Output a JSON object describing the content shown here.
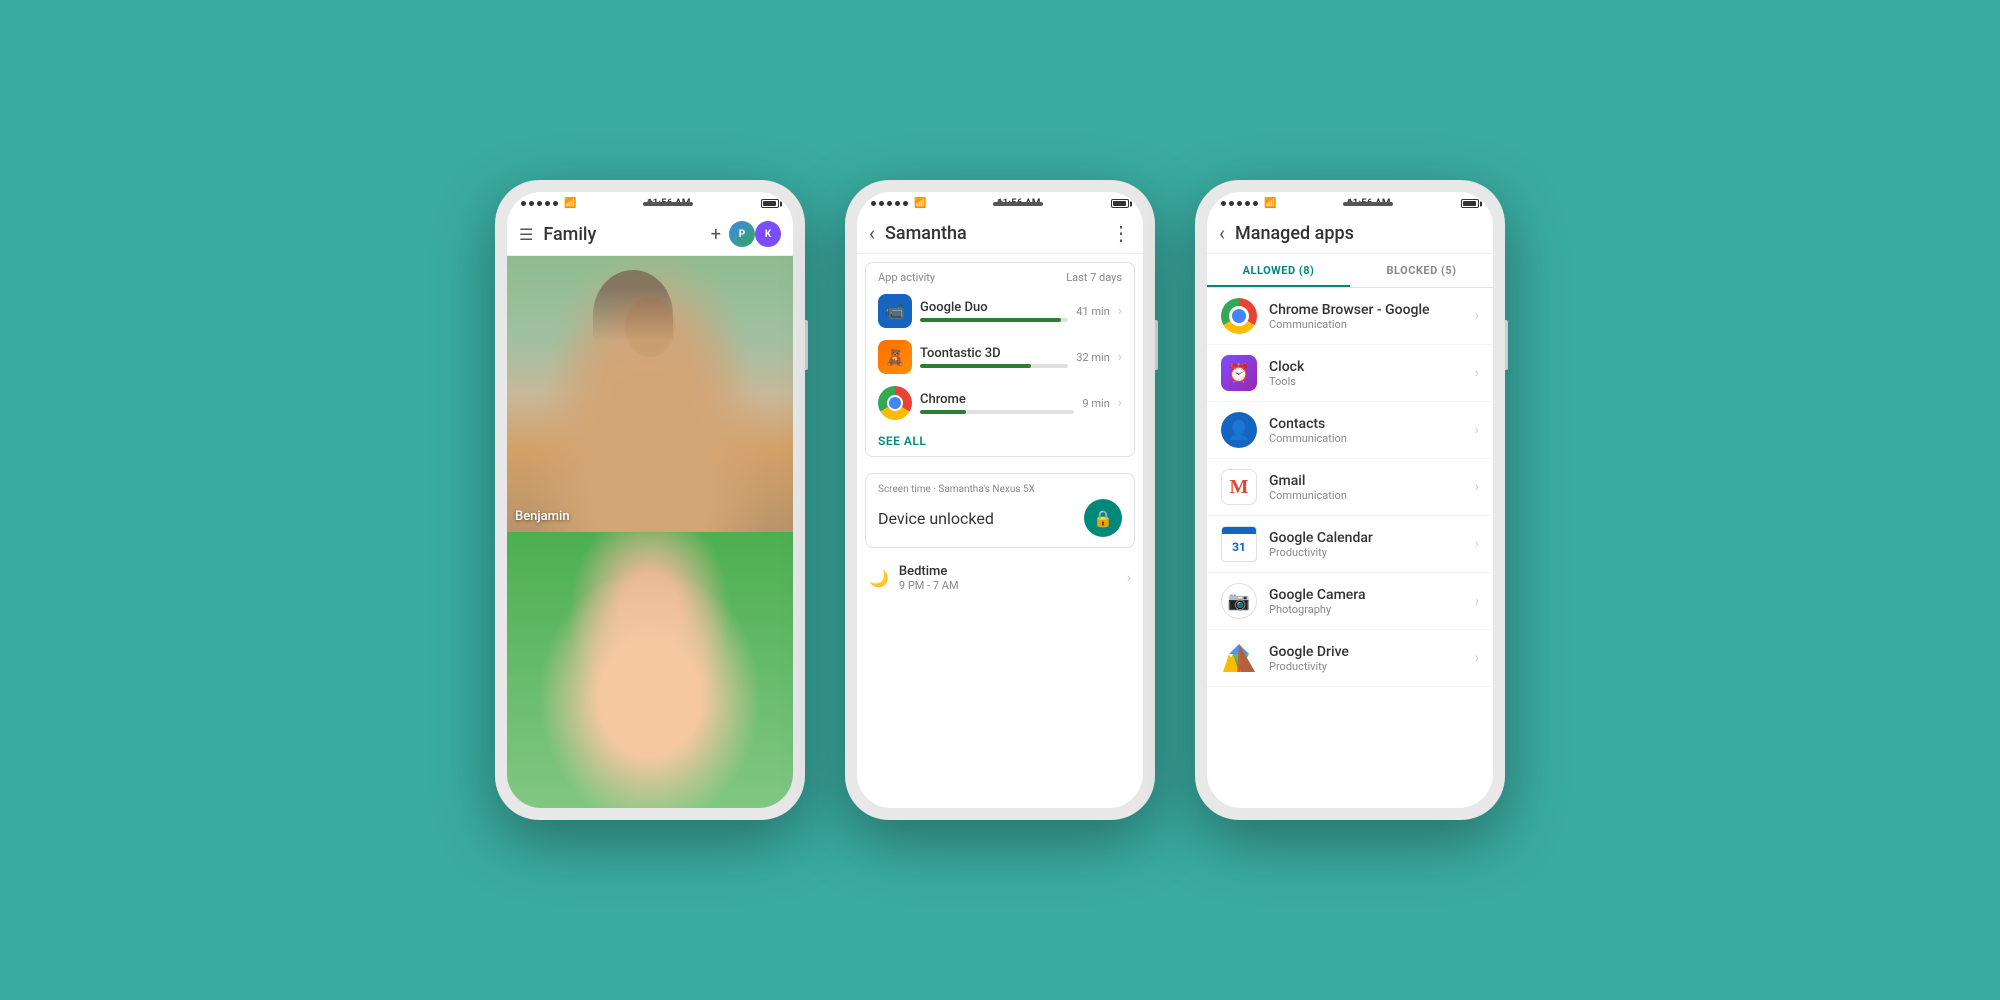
{
  "background": "#3aaba0",
  "phones": {
    "phone1": {
      "statusBar": {
        "time": "11:56 AM",
        "dots": 5
      },
      "header": {
        "title": "Family",
        "plusLabel": "+",
        "avatarLabel1": "P",
        "avatarLabel2": "K"
      },
      "children": [
        {
          "name": "Benjamin",
          "photoType": "boy"
        },
        {
          "name": "",
          "photoType": "girl"
        }
      ]
    },
    "phone2": {
      "statusBar": {
        "time": "11:56 AM"
      },
      "header": {
        "title": "Samantha"
      },
      "activitySection": {
        "label": "App activity",
        "period": "Last 7 days",
        "apps": [
          {
            "name": "Google Duo",
            "time": "41 min",
            "progress": 95,
            "iconType": "duo"
          },
          {
            "name": "Toontastic 3D",
            "time": "32 min",
            "progress": 75,
            "iconType": "toontastic"
          },
          {
            "name": "Chrome",
            "time": "9 min",
            "progress": 30,
            "iconType": "chrome"
          }
        ],
        "seeAll": "SEE ALL"
      },
      "screenTime": {
        "header": "Screen time · Samantha's Nexus 5X",
        "title": "Device unlocked"
      },
      "bedtime": {
        "label": "Bedtime",
        "time": "9 PM - 7 AM"
      }
    },
    "phone3": {
      "statusBar": {
        "time": "11:56 AM"
      },
      "header": {
        "title": "Managed apps"
      },
      "tabs": [
        {
          "label": "ALLOWED (8)",
          "active": true
        },
        {
          "label": "BLOCKED (5)",
          "active": false
        }
      ],
      "apps": [
        {
          "name": "Chrome Browser - Google",
          "category": "Communication",
          "iconType": "chrome"
        },
        {
          "name": "Clock",
          "category": "Tools",
          "iconType": "clock"
        },
        {
          "name": "Contacts",
          "category": "Communication",
          "iconType": "contacts"
        },
        {
          "name": "Gmail",
          "category": "Communication",
          "iconType": "gmail"
        },
        {
          "name": "Google Calendar",
          "category": "Productivity",
          "iconType": "gcal",
          "num": "31"
        },
        {
          "name": "Google Camera",
          "category": "Photography",
          "iconType": "gcam"
        },
        {
          "name": "Google Drive",
          "category": "Productivity",
          "iconType": "gdrive"
        }
      ]
    }
  }
}
